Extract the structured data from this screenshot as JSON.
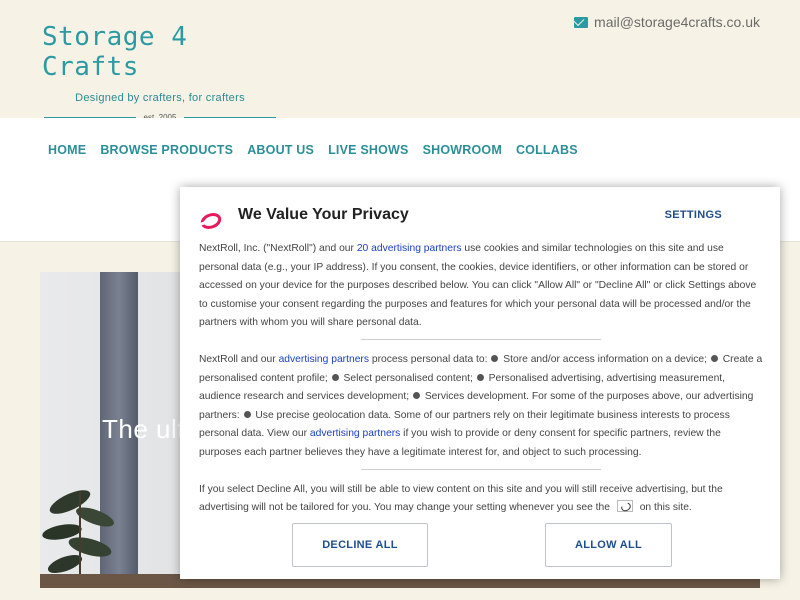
{
  "site": {
    "title": "Storage 4 Crafts",
    "tagline": "Designed by crafters, for crafters",
    "established": "est. 2005",
    "email": "mail@storage4crafts.co.uk"
  },
  "nav": {
    "items": [
      {
        "label": "HOME"
      },
      {
        "label": "BROWSE PRODUCTS"
      },
      {
        "label": "ABOUT US"
      },
      {
        "label": "LIVE SHOWS"
      },
      {
        "label": "SHOWROOM"
      },
      {
        "label": "COLLABS"
      }
    ]
  },
  "hero": {
    "text": "The ult"
  },
  "consent": {
    "title": "We Value Your Privacy",
    "settings_label": "SETTINGS",
    "p1": {
      "pre": "NextRoll, Inc. (\"NextRoll\") and our ",
      "link": "20 advertising partners",
      "post": " use cookies and similar technologies on this site and use personal data (e.g., your IP address). If you consent, the cookies, device identifiers, or other information can be stored or accessed on your device for the purposes described below. You can click \"Allow All\" or \"Decline All\" or click Settings above to customise your consent regarding the purposes and features for which your personal data will be processed and/or the partners with whom you will share personal data."
    },
    "p2": {
      "pre": "NextRoll and our ",
      "link1": "advertising partners",
      "mid1": " process personal data to: ",
      "purpose1": "Store and/or access information on a device; ",
      "purpose2": "Create a personalised content profile; ",
      "purpose3": "Select personalised content; ",
      "purpose4": "Personalised advertising, advertising measurement, audience research and services development; ",
      "purpose5": "Services development. For some of the purposes above, our advertising partners: ",
      "purpose6": "Use precise geolocation data. Some of our partners rely on their legitimate business interests to process personal data. View our ",
      "link2": "advertising partners",
      "post": " if you wish to provide or deny consent for specific partners, review the purposes each partner believes they have a legitimate interest for, and object to such processing."
    },
    "p3": {
      "pre": "If you select Decline All, you will still be able to view content on this site and you will still receive advertising, but the advertising will not be tailored for you. You may change your setting whenever you see the ",
      "post": " on this site."
    },
    "decline_label": "DECLINE ALL",
    "allow_label": "ALLOW ALL"
  },
  "colors": {
    "brand_teal": "#2b9aa4",
    "consent_accent": "#e8195a",
    "link_blue": "#1a3fc0"
  }
}
